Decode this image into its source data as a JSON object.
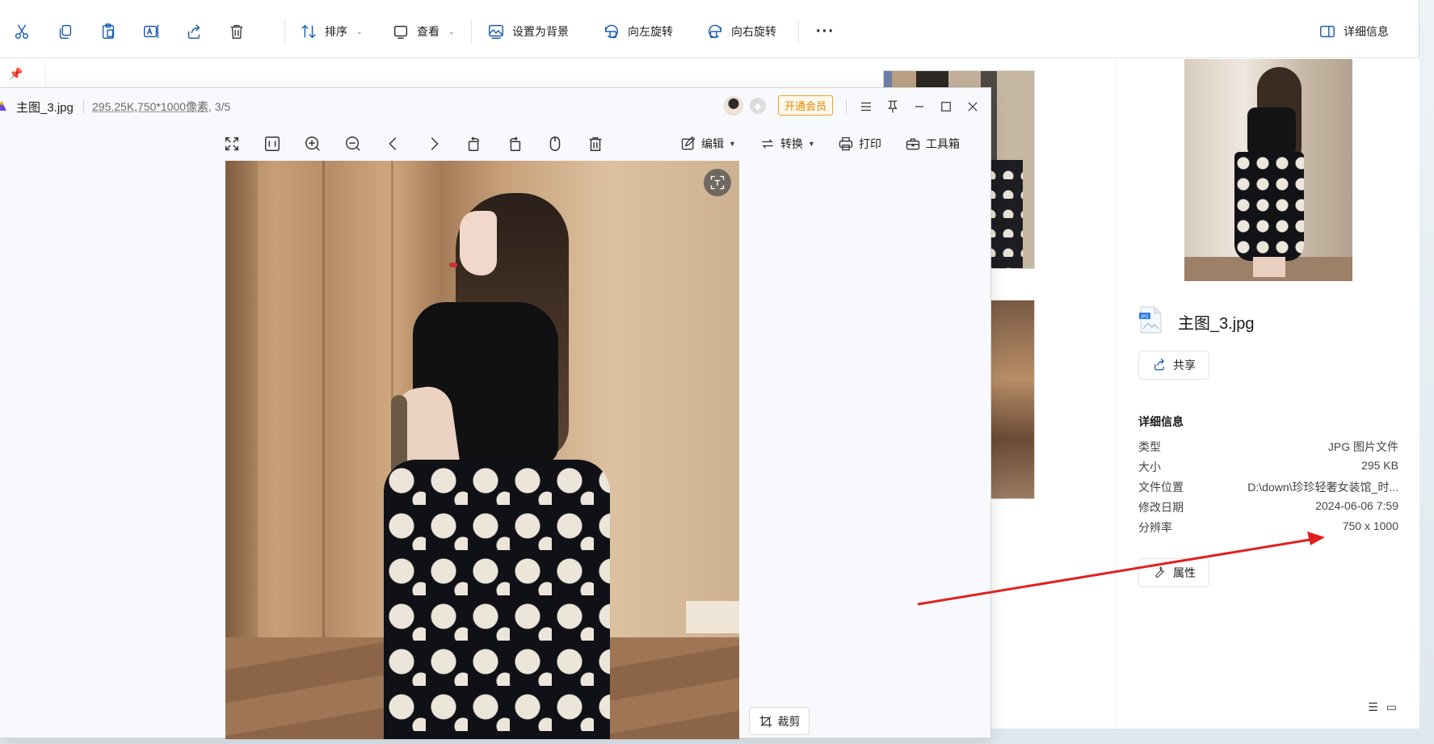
{
  "explorer": {
    "toolbar": {
      "sort": "排序",
      "view": "查看",
      "set_background": "设置为背景",
      "rotate_left": "向左旋转",
      "rotate_right": "向右旋转",
      "more": "···",
      "details": "详细信息"
    },
    "preview": {
      "file_name": "主图_3.jpg",
      "share": "共享",
      "section_title": "详细信息",
      "rows": [
        {
          "key": "类型",
          "value": "JPG 图片文件"
        },
        {
          "key": "大小",
          "value": "295 KB"
        },
        {
          "key": "文件位置",
          "value": "D:\\down\\珍珍轻奢女装馆_时..."
        },
        {
          "key": "修改日期",
          "value": "2024-06-06 7:59"
        },
        {
          "key": "分辨率",
          "value": "750 x 1000"
        }
      ],
      "properties": "属性"
    }
  },
  "viewer": {
    "title": "主图_3.jpg",
    "size": "295.25K",
    "dimensions": ",750*1000像素",
    "index": ", 3/5",
    "vip": "开通会员",
    "tools": {
      "edit": "编辑",
      "convert": "转换",
      "print": "打印",
      "toolbox": "工具箱"
    },
    "crop": "裁剪"
  },
  "colors": {
    "accent_vip": "#f0a12a",
    "arrow_red": "#e02020"
  },
  "icons": [
    "cut-icon",
    "copy-icon",
    "paste-icon",
    "rename-icon",
    "share-icon",
    "delete-icon",
    "sort-icon",
    "view-icon",
    "wallpaper-icon",
    "rotate-left-icon",
    "rotate-right-icon",
    "details-pane-icon"
  ]
}
